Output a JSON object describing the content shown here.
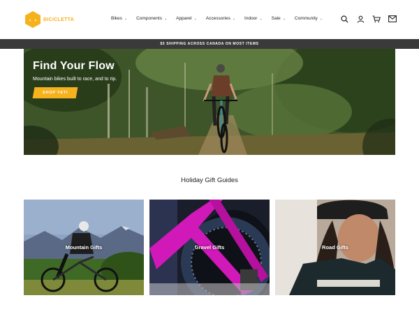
{
  "brand": {
    "name": "BICICLETTA",
    "accent": "#f6b21d"
  },
  "nav": [
    {
      "label": "Bikes"
    },
    {
      "label": "Components"
    },
    {
      "label": "Apparel"
    },
    {
      "label": "Accessories"
    },
    {
      "label": "Indoor"
    },
    {
      "label": "Sale"
    },
    {
      "label": "Community"
    }
  ],
  "header_icons": [
    "search-icon",
    "account-icon",
    "cart-icon",
    "mail-icon"
  ],
  "shipping_bar": {
    "text": "$5 SHIPPING ACROSS CANADA ON MOST ITEMS"
  },
  "hero": {
    "title": "Find Your Flow",
    "subtitle": "Mountain bikes built to race, and to rip.",
    "button": "SHOP YETI"
  },
  "gift_section": {
    "title": "Holiday Gift Guides",
    "cards": [
      {
        "label": "Mountain Gifts"
      },
      {
        "label": "Gravel Gifts"
      },
      {
        "label": "Road Gifts"
      }
    ]
  }
}
